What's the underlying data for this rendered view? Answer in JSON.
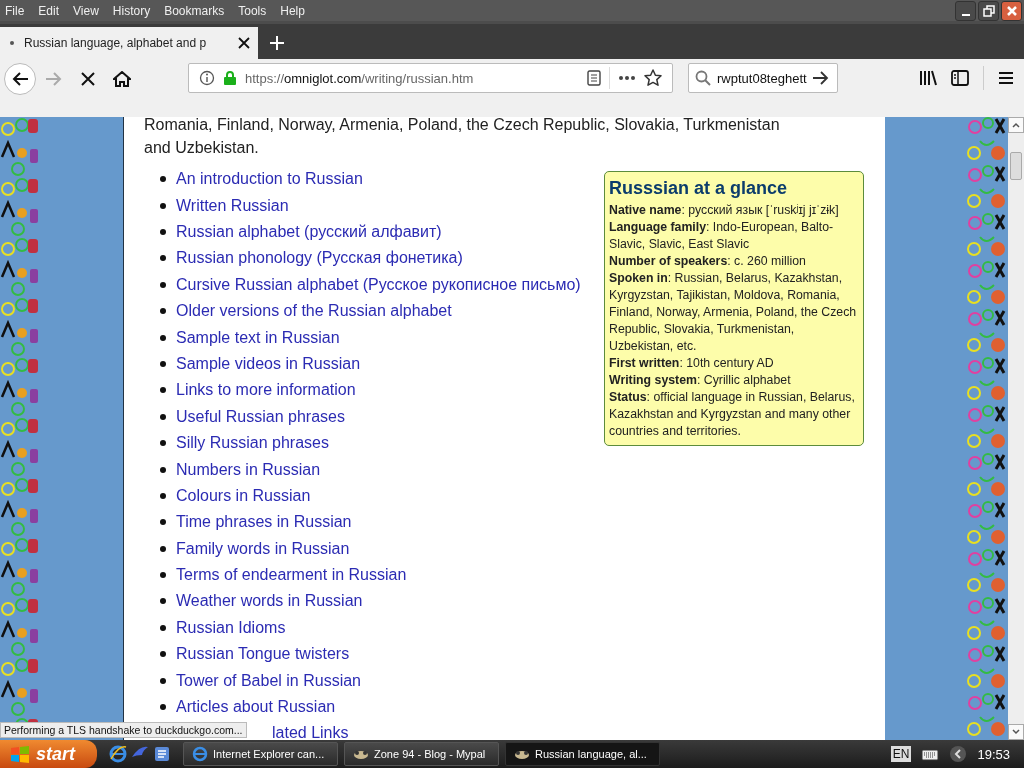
{
  "menu": [
    "File",
    "Edit",
    "View",
    "History",
    "Bookmarks",
    "Tools",
    "Help"
  ],
  "tabs": [
    {
      "title": "Russian language, alphabet and p",
      "selected": true
    }
  ],
  "nav": {
    "forward_disabled": true,
    "url": {
      "scheme": "https://",
      "host": "omniglot.com",
      "path": "/writing/russian.htm"
    },
    "search_value": "rwptut08teghett"
  },
  "page": {
    "intro": "Romania, Finland, Norway, Armenia, Poland, the Czech Republic, Slovakia, Turkmenistan and Uzbekistan.",
    "links": [
      "An introduction to Russian",
      "Written Russian",
      "Russian alphabet (русский алфавит)",
      "Russian phonology (Русская фонетика)",
      "Cursive Russian alphabet (Русское рукописное письмо)",
      "Older versions of the Russian alphabet",
      "Sample text in Russian",
      "Sample videos in Russian",
      "Links to more information",
      "Useful Russian phrases",
      "Silly Russian phrases",
      "Numbers in Russian",
      "Colours in Russian",
      "Time phrases in Russian",
      "Family words in Russian",
      "Terms of endearment in Russian",
      "Weather words in Russian",
      "Russian Idioms",
      "Russian Tongue twisters",
      "Tower of Babel in Russian",
      "Articles about Russian"
    ],
    "last_link": "lated Links",
    "glance": {
      "title": "Russsian at a glance",
      "facts": [
        "**Native name**: русский язык [ˈruskʲɪj jɪˈzɨk]",
        "**Language family**: Indo-European, Balto-Slavic, Slavic, East Slavic",
        "**Number of speakers**: c. 260 million",
        "**Spoken in**: Russian, Belarus, Kazakhstan, Kyrgyzstan, Tajikistan, Moldova, Romania, Finland, Norway, Armenia, Poland, the Czech Republic, Slovakia, Turkmenistan, Uzbekistan, etc.",
        "**First written**: 10th century AD",
        "**Writing system**: Cyrillic alphabet",
        "**Status**: official language in Russian, Belarus, Kazakhstan and Kyrgyzstan and many other countries and territories."
      ]
    }
  },
  "status_text": "Performing a TLS handshake to duckduckgo.com...",
  "taskbar": {
    "start": "start",
    "tasks": [
      {
        "title": "Internet Explorer can...",
        "selected": false
      },
      {
        "title": "Zone 94 - Blog - Mypal",
        "selected": false
      },
      {
        "title": "Russian language, al...",
        "selected": true
      }
    ],
    "language": "EN",
    "clock": "19:53"
  }
}
